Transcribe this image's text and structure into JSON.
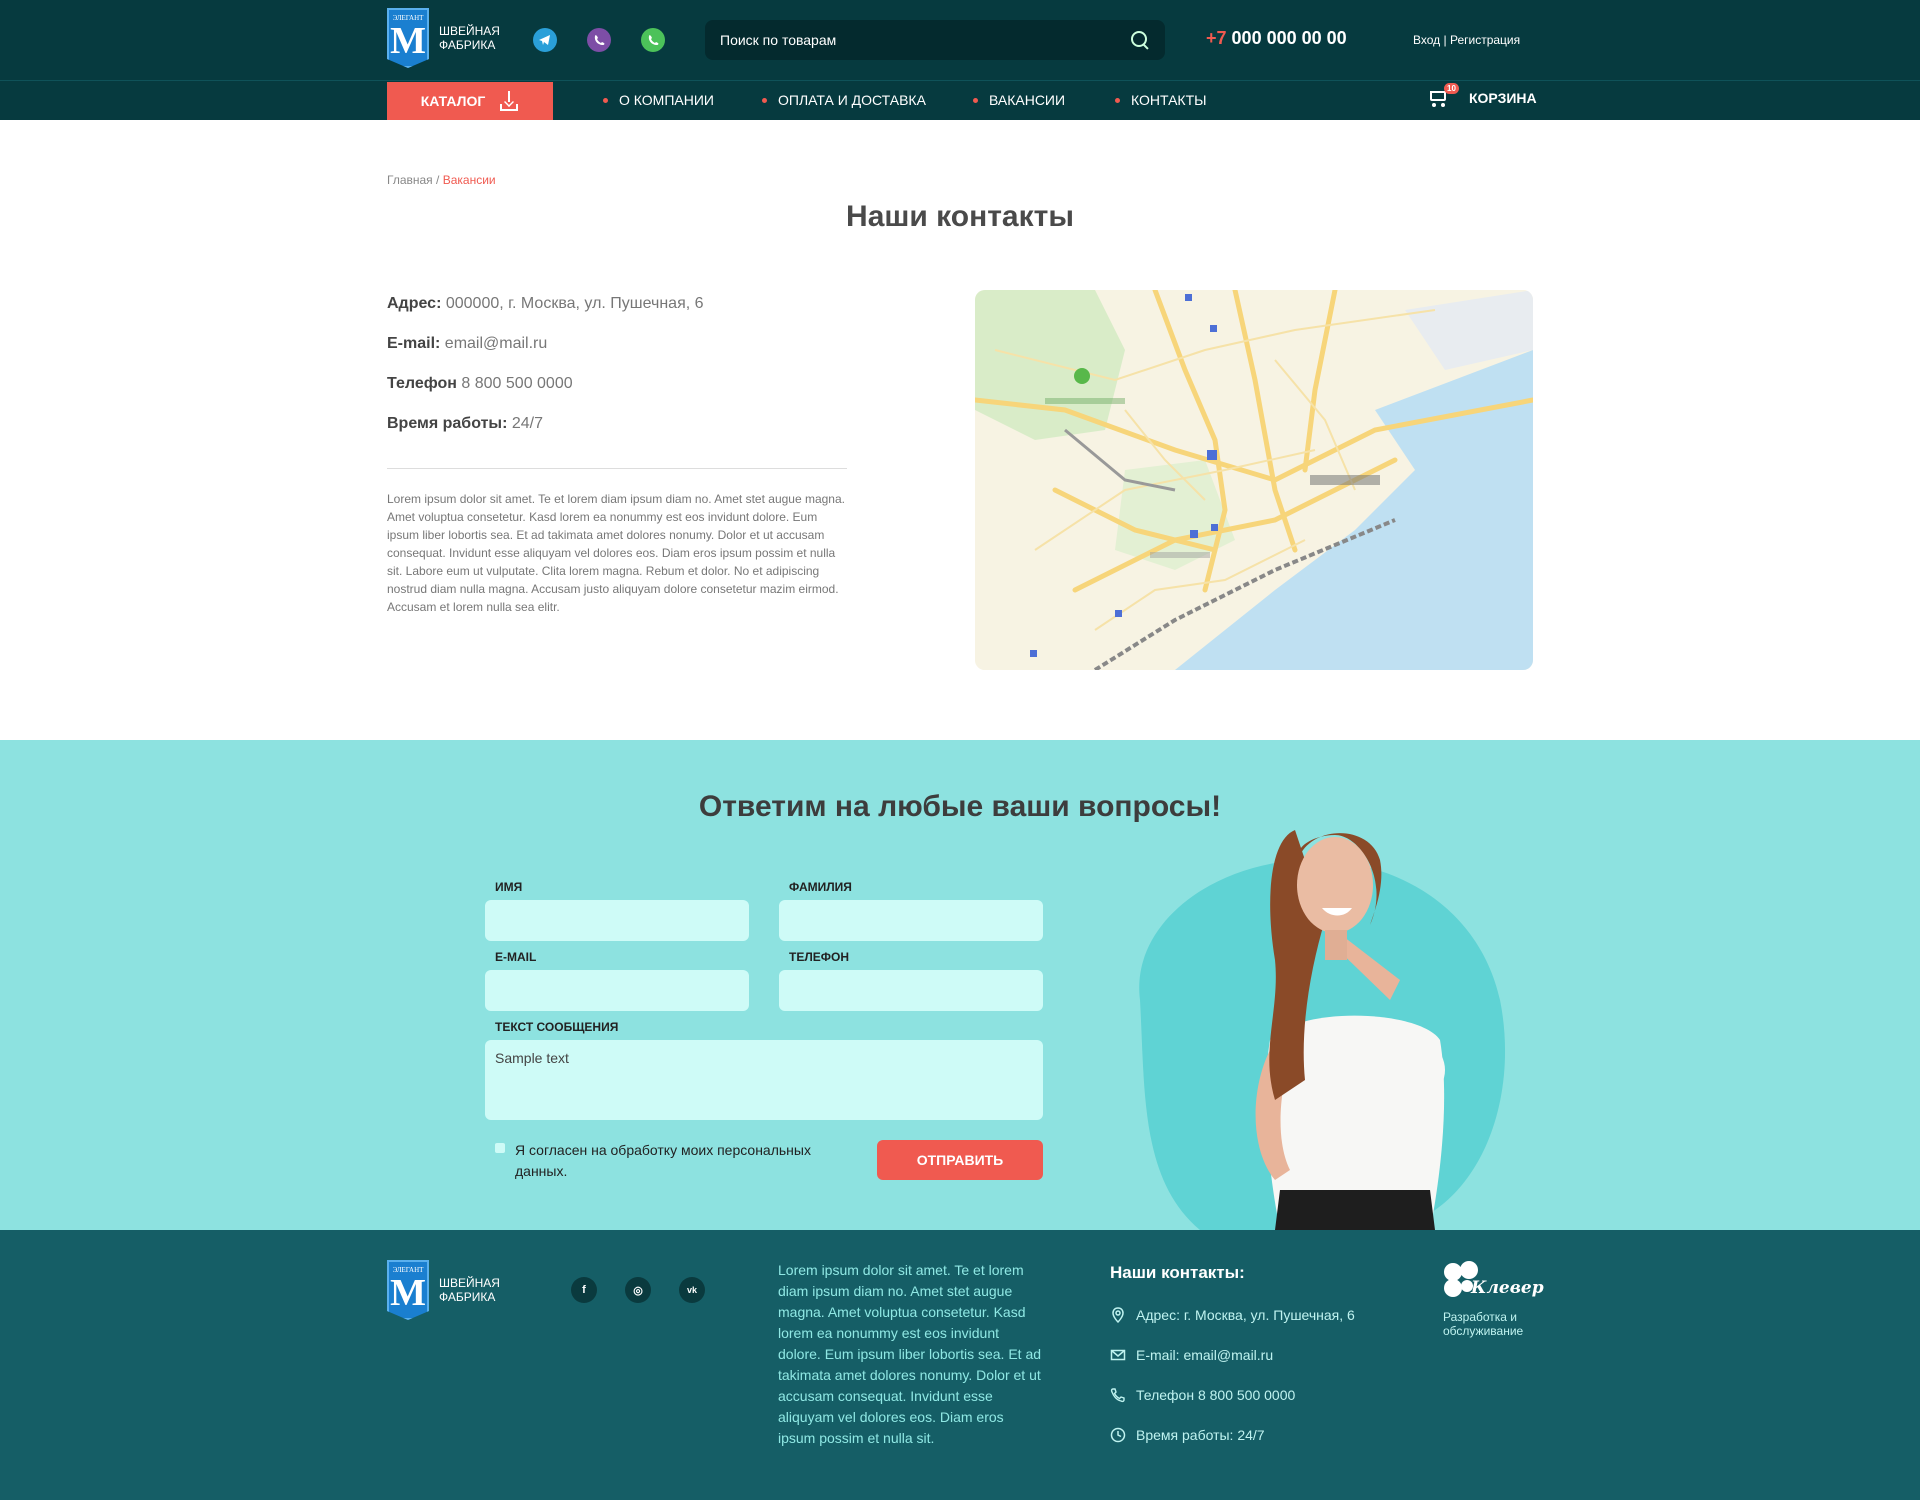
{
  "header": {
    "logo": {
      "top_mark": "ЭЛЕГАНТ",
      "letter": "M",
      "line1": "ШВЕЙНАЯ",
      "line2": "ФАБРИКА"
    },
    "messengers": [
      "telegram-icon",
      "viber-icon",
      "whatsapp-icon"
    ],
    "search": {
      "placeholder": "Поиск по товарам"
    },
    "phone": {
      "code": "+7",
      "number": "000 000 00 00"
    },
    "auth": {
      "login": "Вход",
      "separator": "|",
      "register": "Регистрация"
    }
  },
  "nav": {
    "catalog_label": "КАТАЛОГ",
    "items": [
      "О КОМПАНИИ",
      "ОПЛАТА И ДОСТАВКА",
      "ВАКАНСИИ",
      "КОНТАКТЫ"
    ],
    "cart_label": "КОРЗИНА",
    "cart_count": "10"
  },
  "breadcrumb": {
    "home": "Главная",
    "separator": "/",
    "current": "Вакансии"
  },
  "page": {
    "title": "Наши контакты",
    "address_label": "Адрес:",
    "address": "000000, г. Москва, ул. Пушечная, 6",
    "email_label": "E-mail:",
    "email": "email@mail.ru",
    "phone_label": "Телефон",
    "phone": "8 800 500 0000",
    "hours_label": "Время работы:",
    "hours": "24/7",
    "lorem": "Lorem ipsum dolor sit amet. Te et lorem diam ipsum diam no. Amet stet augue magna. Amet voluptua consetetur. Kasd lorem ea nonummy est eos invidunt dolore. Eum ipsum liber lobortis sea. Et ad takimata amet dolores nonumy. Dolor et ut accusam consequat. Invidunt esse aliquyam vel dolores eos. Diam eros ipsum possim et nulla sit. Labore eum ut vulputate. Clita lorem magna. Rebum et dolor. No et adipiscing nostrud diam nulla magna. Accusam justo aliquyam dolore consetetur mazim eirmod. Accusam et lorem nulla sea elitr."
  },
  "form": {
    "title": "Ответим на любые ваши вопросы!",
    "first_name_label": "Имя",
    "last_name_label": "Фамилия",
    "email_label": "E-mail",
    "phone_label": "Телефон",
    "message_label": "Текст сообщения",
    "message_placeholder": "Sample text",
    "agree_text": "Я согласен на обработку моих персональных данных.",
    "submit_label": "Отправить"
  },
  "footer": {
    "logo": {
      "top_mark": "ЭЛЕГАНТ",
      "letter": "M",
      "line1": "ШВЕЙНАЯ",
      "line2": "ФАБРИКА"
    },
    "social": [
      {
        "icon": "facebook-icon",
        "glyph": "f"
      },
      {
        "icon": "instagram-icon",
        "glyph": "◎"
      },
      {
        "icon": "vk-icon",
        "glyph": "vk"
      }
    ],
    "lorem": "Lorem ipsum dolor sit amet. Te et lorem diam ipsum diam no. Amet stet augue magna. Amet voluptua consetetur. Kasd lorem ea nonummy est eos invidunt dolore. Eum ipsum liber lobortis sea. Et ad takimata amet dolores nonumy. Dolor et ut accusam consequat. Invidunt esse aliquyam vel dolores eos. Diam eros ipsum possim et nulla sit.",
    "contacts_title": "Наши контакты:",
    "address": "Адрес: г. Москва, ул. Пушечная, 6",
    "email": "E-mail: email@mail.ru",
    "phone": "Телефон 8 800 500 0000",
    "hours": "Время работы: 24/7",
    "dev_brand": "Клевер",
    "dev_text": "Разработка и обслуживание"
  },
  "colors": {
    "header_bg": "#063a3f",
    "accent": "#f05a50",
    "form_bg": "#8de2e0",
    "footer_bg": "#155e66",
    "input_bg": "#cefbf7"
  }
}
